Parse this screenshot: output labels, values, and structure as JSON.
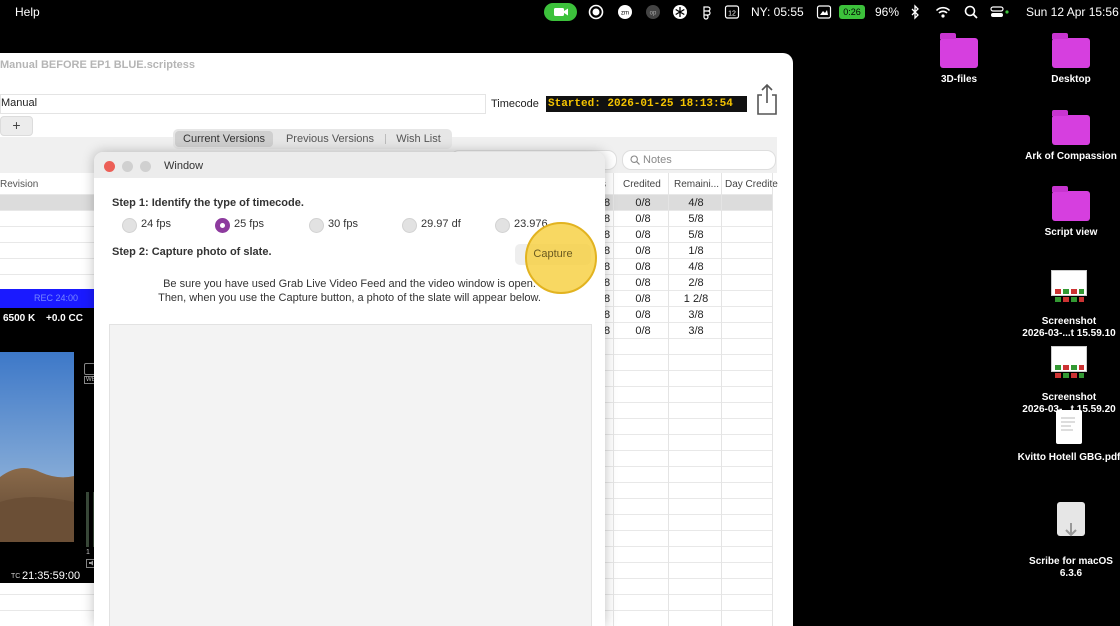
{
  "menubar": {
    "help": "Help",
    "clock_ny": "NY: 05:55",
    "battery_badge": "0:26",
    "battery_percent": "96%",
    "date": "Sun 12 Apr  15:56",
    "status_icons": [
      "camera-icon",
      "record-icon",
      "zoom-icon",
      "op-icon",
      "snowflake-icon",
      "figma-icon",
      "calendar-icon",
      "screenshot-icon",
      "bluetooth-icon",
      "wifi-icon",
      "search-icon",
      "control-center-icon"
    ],
    "calendar_day": "12",
    "zoom_label": "zm",
    "op_label": "op"
  },
  "desktop": {
    "items": [
      {
        "label": "3D-files",
        "kind": "folder"
      },
      {
        "label": "Desktop",
        "kind": "folder"
      },
      {
        "label": "Ark of Compassion",
        "kind": "folder"
      },
      {
        "label": "Script view",
        "kind": "folder"
      },
      {
        "label": "Screenshot\n2026-03-...t 15.59.10",
        "kind": "thumb"
      },
      {
        "label": "Screenshot\n2026-03-...t 15.59.20",
        "kind": "thumb"
      },
      {
        "label": "Kvitto Hotell GBG.pdf",
        "kind": "doc"
      },
      {
        "label": "Scribe for macOS\n6.3.6",
        "kind": "pkg"
      }
    ]
  },
  "app": {
    "title": "Manual BEFORE EP1 BLUE.scriptess",
    "doc_name": "Manual",
    "plus_label": "+",
    "timecode_label": "Timecode",
    "timecode_value": "Started: 2026-01-25 18:13:54",
    "tabs": [
      "Current Versions",
      "Previous Versions",
      "Wish List"
    ],
    "notes_placeholder": "Notes",
    "left_column_header": "Revision",
    "table": {
      "headers": [
        "s",
        "Credited",
        "Remaini...",
        "Day Credite"
      ],
      "rows": [
        [
          "/8",
          "0/8",
          "4/8"
        ],
        [
          "/8",
          "0/8",
          "5/8"
        ],
        [
          "/8",
          "0/8",
          "5/8"
        ],
        [
          "/8",
          "0/8",
          "1/8"
        ],
        [
          "/8",
          "0/8",
          "4/8"
        ],
        [
          "/8",
          "0/8",
          "2/8"
        ],
        [
          "/8",
          "0/8",
          "1 2/8"
        ],
        [
          "/8",
          "0/8",
          "3/8"
        ],
        [
          "/8",
          "0/8",
          "3/8"
        ]
      ]
    }
  },
  "dialog": {
    "title": "Window",
    "step1": "Step 1: Identify the type of timecode.",
    "fps_options": [
      "24 fps",
      "25 fps",
      "30 fps",
      "29.97 df",
      "23.976"
    ],
    "fps_selected": "25 fps",
    "step2": "Step 2: Capture photo of slate.",
    "capture_button": "Capture",
    "hint_line1": "Be sure you have used Grab Live Video Feed and the video window is open.",
    "hint_line2": "Then, when you use the Capture button, a photo of the slate will appear below."
  },
  "video": {
    "top_bar_text": "REC 24:00",
    "white_balance": "6500 K",
    "tint": "+0.0 CC",
    "timecode": "21:35:59:00",
    "tc_prefix": "TC",
    "wb_badge": "WBS",
    "meter_labels": "1 2"
  },
  "colors": {
    "facetime_green": "#3cc13b",
    "timecode_bg": "#111111",
    "timecode_fg": "#f5c400",
    "folder_purple": "#d63fdf",
    "radio_selected": "#8d3b9e",
    "highlight_circle": "#f7cf3f"
  }
}
